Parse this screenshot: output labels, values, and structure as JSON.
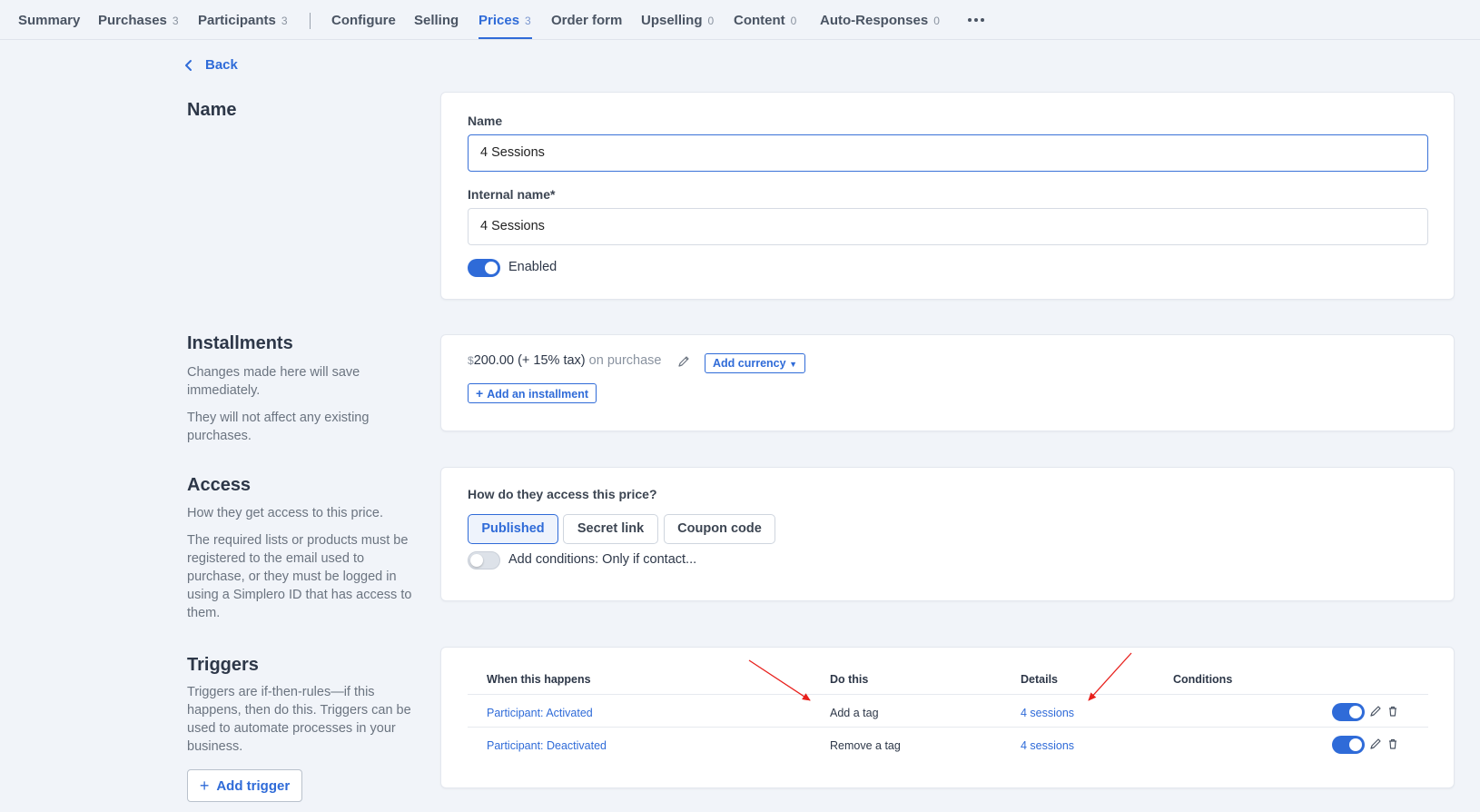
{
  "nav": {
    "tabs": [
      {
        "label": "Summary",
        "count": ""
      },
      {
        "label": "Purchases",
        "count": "3"
      },
      {
        "label": "Participants",
        "count": "3"
      },
      {
        "label": "Configure",
        "count": ""
      },
      {
        "label": "Selling",
        "count": ""
      },
      {
        "label": "Prices",
        "count": "3"
      },
      {
        "label": "Order form",
        "count": ""
      },
      {
        "label": "Upselling",
        "count": "0"
      },
      {
        "label": "Content",
        "count": "0"
      },
      {
        "label": "Auto-Responses",
        "count": "0"
      }
    ],
    "active_tab": "Prices"
  },
  "back_label": "Back",
  "name_section": {
    "title": "Name",
    "name_label": "Name",
    "name_value": "4 Sessions",
    "internal_label": "Internal name*",
    "internal_value": "4 Sessions",
    "enabled_label": "Enabled",
    "enabled": true
  },
  "installments": {
    "title": "Installments",
    "desc1": "Changes made here will save immediately.",
    "desc2": "They will not affect any existing purchases.",
    "currency_symbol": "$",
    "amount": "200.00 (+ 15% tax)",
    "when": "on purchase",
    "add_currency": "Add currency",
    "add_installment": "Add an installment"
  },
  "access": {
    "title": "Access",
    "desc1": "How they get access to this price.",
    "desc2": "The required lists or products must be registered to the email used to purchase, or they must be logged in using a Simplero ID that has access to them.",
    "question": "How do they access this price?",
    "options": [
      "Published",
      "Secret link",
      "Coupon code"
    ],
    "selected": "Published",
    "conditions_label": "Add conditions: Only if contact...",
    "conditions_enabled": false
  },
  "triggers": {
    "title": "Triggers",
    "desc": "Triggers are if-then-rules—if this happens, then do this. Triggers can be used to automate processes in your business.",
    "columns": [
      "When this happens",
      "Do this",
      "Details",
      "Conditions"
    ],
    "rows": [
      {
        "when": "Participant: Activated",
        "do": "Add a tag",
        "details": "4 sessions",
        "conditions": "",
        "enabled": true
      },
      {
        "when": "Participant: Deactivated",
        "do": "Remove a tag",
        "details": "4 sessions",
        "conditions": "",
        "enabled": true
      }
    ],
    "add_label": "Add trigger"
  },
  "colors": {
    "accent": "#2f6bd8",
    "background": "#f1f4f9",
    "annotation_arrow": "#e8201c"
  }
}
